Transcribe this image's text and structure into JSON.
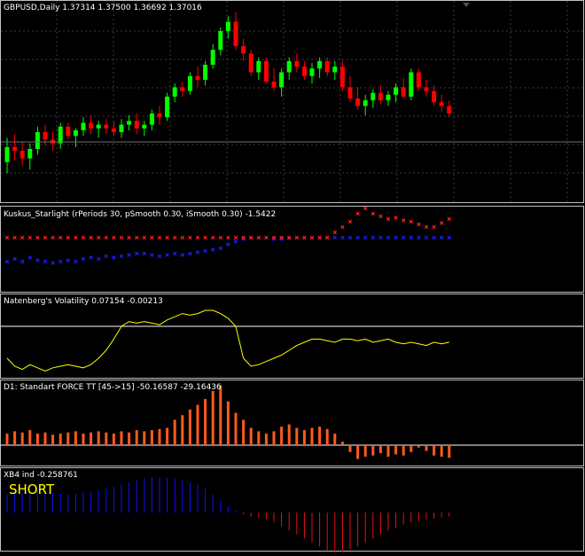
{
  "colors": {
    "background": "#000000",
    "grid": "#3c3c3c",
    "separator": "#c0c0c0",
    "bull": "#00ff00",
    "bear": "#ff0000",
    "text": "#ffffff",
    "starlight_blue": "#2020ff",
    "starlight_red": "#ff2020",
    "volatility_line": "#ffff00",
    "level_line": "#ffffff",
    "force_bar": "#ff5a1e",
    "xb4_pos": "#1010ff",
    "xb4_neg": "#e81010",
    "short_text": "#ffff00"
  },
  "main": {
    "header": "GBPUSD,Daily  1.37314 1.37500 1.36692 1.37016",
    "scroll_marker_icon": "triangle-down-icon"
  },
  "indicators": {
    "kuskus": {
      "label": "Kuskus_Starlight  (rPeriods 30, pSmooth 0.30, iSmooth 0.30)  -1.5422"
    },
    "volatility": {
      "label": "Natenberg's Volatility 0.07154 -0.00213"
    },
    "force": {
      "label": "D1: Standart FORCE TT [45->15] -50.16587 -29.16436"
    },
    "xb4": {
      "label": "XB4 ind -0.258761",
      "signal": "SHORT"
    }
  },
  "chart_data": [
    {
      "type": "candlestick",
      "title": "GBPUSD,Daily",
      "ohlc_last": {
        "open": 1.37314,
        "high": 1.375,
        "low": 1.36692,
        "close": 1.37016
      },
      "bars": 61,
      "candles": [
        [
          0.2,
          0.33,
          0.14,
          0.28
        ],
        [
          0.28,
          0.35,
          0.21,
          0.26
        ],
        [
          0.26,
          0.31,
          0.18,
          0.22
        ],
        [
          0.22,
          0.3,
          0.16,
          0.27
        ],
        [
          0.27,
          0.39,
          0.24,
          0.36
        ],
        [
          0.36,
          0.4,
          0.29,
          0.32
        ],
        [
          0.32,
          0.36,
          0.26,
          0.3
        ],
        [
          0.3,
          0.41,
          0.27,
          0.39
        ],
        [
          0.39,
          0.41,
          0.32,
          0.34
        ],
        [
          0.34,
          0.38,
          0.28,
          0.37
        ],
        [
          0.37,
          0.44,
          0.34,
          0.41
        ],
        [
          0.41,
          0.45,
          0.35,
          0.38
        ],
        [
          0.38,
          0.42,
          0.33,
          0.4
        ],
        [
          0.4,
          0.43,
          0.35,
          0.38
        ],
        [
          0.38,
          0.42,
          0.34,
          0.36
        ],
        [
          0.36,
          0.43,
          0.33,
          0.4
        ],
        [
          0.4,
          0.45,
          0.37,
          0.42
        ],
        [
          0.42,
          0.46,
          0.35,
          0.38
        ],
        [
          0.38,
          0.42,
          0.34,
          0.4
        ],
        [
          0.4,
          0.48,
          0.37,
          0.46
        ],
        [
          0.46,
          0.5,
          0.4,
          0.44
        ],
        [
          0.44,
          0.57,
          0.42,
          0.55
        ],
        [
          0.55,
          0.62,
          0.52,
          0.6
        ],
        [
          0.6,
          0.63,
          0.55,
          0.58
        ],
        [
          0.58,
          0.68,
          0.56,
          0.66
        ],
        [
          0.66,
          0.71,
          0.6,
          0.64
        ],
        [
          0.64,
          0.74,
          0.61,
          0.72
        ],
        [
          0.72,
          0.83,
          0.7,
          0.8
        ],
        [
          0.8,
          0.92,
          0.77,
          0.9
        ],
        [
          0.9,
          0.98,
          0.86,
          0.95
        ],
        [
          0.95,
          1.0,
          0.8,
          0.82
        ],
        [
          0.82,
          0.86,
          0.74,
          0.78
        ],
        [
          0.78,
          0.8,
          0.66,
          0.68
        ],
        [
          0.68,
          0.76,
          0.64,
          0.74
        ],
        [
          0.74,
          0.76,
          0.62,
          0.63
        ],
        [
          0.63,
          0.7,
          0.58,
          0.6
        ],
        [
          0.6,
          0.7,
          0.55,
          0.68
        ],
        [
          0.68,
          0.76,
          0.64,
          0.74
        ],
        [
          0.74,
          0.78,
          0.68,
          0.71
        ],
        [
          0.71,
          0.74,
          0.64,
          0.66
        ],
        [
          0.66,
          0.73,
          0.62,
          0.7
        ],
        [
          0.7,
          0.76,
          0.65,
          0.74
        ],
        [
          0.74,
          0.76,
          0.66,
          0.68
        ],
        [
          0.68,
          0.74,
          0.64,
          0.71
        ],
        [
          0.71,
          0.74,
          0.58,
          0.6
        ],
        [
          0.6,
          0.66,
          0.52,
          0.54
        ],
        [
          0.54,
          0.6,
          0.48,
          0.5
        ],
        [
          0.5,
          0.56,
          0.45,
          0.53
        ],
        [
          0.53,
          0.59,
          0.49,
          0.57
        ],
        [
          0.57,
          0.61,
          0.51,
          0.53
        ],
        [
          0.53,
          0.58,
          0.5,
          0.56
        ],
        [
          0.56,
          0.62,
          0.52,
          0.6
        ],
        [
          0.6,
          0.65,
          0.54,
          0.55
        ],
        [
          0.55,
          0.7,
          0.53,
          0.68
        ],
        [
          0.68,
          0.7,
          0.58,
          0.6
        ],
        [
          0.6,
          0.64,
          0.55,
          0.58
        ],
        [
          0.58,
          0.61,
          0.5,
          0.52
        ],
        [
          0.52,
          0.56,
          0.47,
          0.5
        ],
        [
          0.5,
          0.53,
          0.44,
          0.46
        ]
      ]
    },
    {
      "type": "scatter",
      "title": "Kuskus_Starlight",
      "series": [
        {
          "values": [
            -0.8,
            -0.6,
            -0.8,
            -0.5,
            -0.7,
            -0.8,
            -0.9,
            -0.8,
            -0.7,
            -0.8,
            -0.6,
            -0.5,
            -0.6,
            -0.4,
            -0.5,
            -0.4,
            -0.3,
            -0.2,
            -0.2,
            -0.3,
            -0.4,
            -0.3,
            -0.2,
            -0.3,
            -0.2,
            -0.1,
            0.0,
            0.1,
            0.2,
            0.5,
            0.7,
            0.9,
            1.0,
            1.0,
            1.0,
            0.9,
            0.9,
            0.95,
            1.0,
            1.0,
            1.0,
            1.0,
            1.0,
            1.0,
            1.0,
            1.0,
            1.0,
            1.0,
            1.0,
            1.0,
            1.0,
            1.0,
            1.0,
            1.0,
            1.0,
            1.0,
            1.0,
            1.0,
            1.0
          ]
        },
        {
          "values": [
            1.0,
            1.0,
            1.0,
            1.0,
            1.0,
            1.0,
            1.0,
            1.0,
            1.0,
            1.0,
            1.0,
            1.0,
            1.0,
            1.0,
            1.0,
            1.0,
            1.0,
            1.0,
            1.0,
            1.0,
            1.0,
            1.0,
            1.0,
            1.0,
            1.0,
            1.0,
            1.0,
            1.0,
            1.0,
            1.0,
            1.0,
            1.0,
            1.0,
            1.0,
            1.0,
            1.0,
            1.0,
            1.0,
            1.0,
            1.0,
            1.0,
            1.0,
            1.0,
            1.4,
            1.8,
            2.2,
            2.8,
            3.2,
            2.8,
            2.6,
            2.4,
            2.5,
            2.3,
            2.2,
            2.0,
            1.8,
            1.8,
            2.1,
            2.4
          ]
        }
      ]
    },
    {
      "type": "line",
      "title": "Natenberg's Volatility",
      "values": [
        0.1,
        0.05,
        0.03,
        0.06,
        0.04,
        0.02,
        0.04,
        0.05,
        0.06,
        0.05,
        0.04,
        0.06,
        0.1,
        0.15,
        0.22,
        0.3,
        0.33,
        0.32,
        0.33,
        0.32,
        0.31,
        0.34,
        0.36,
        0.38,
        0.37,
        0.38,
        0.4,
        0.4,
        0.38,
        0.35,
        0.3,
        0.1,
        0.05,
        0.06,
        0.08,
        0.1,
        0.12,
        0.15,
        0.18,
        0.2,
        0.22,
        0.22,
        0.21,
        0.2,
        0.22,
        0.22,
        0.21,
        0.22,
        0.2,
        0.21,
        0.22,
        0.2,
        0.19,
        0.2,
        0.19,
        0.18,
        0.2,
        0.19,
        0.2
      ],
      "level": 0.3
    },
    {
      "type": "bar",
      "title": "D1: Standart FORCE TT [45->15]",
      "values": [
        10,
        12,
        11,
        13,
        10,
        11,
        9,
        10,
        11,
        12,
        10,
        11,
        12,
        11,
        10,
        12,
        11,
        13,
        12,
        13,
        14,
        15,
        22,
        26,
        31,
        35,
        40,
        47,
        52,
        38,
        28,
        22,
        15,
        12,
        10,
        12,
        16,
        18,
        15,
        13,
        15,
        16,
        14,
        10,
        3,
        -6,
        -12,
        -10,
        -9,
        -7,
        -10,
        -8,
        -9,
        -6,
        -2,
        -5,
        -9,
        -10,
        -11
      ]
    },
    {
      "type": "bar",
      "title": "XB4 ind",
      "values": [
        0.45,
        0.5,
        0.48,
        0.52,
        0.55,
        0.53,
        0.5,
        0.48,
        0.45,
        0.47,
        0.5,
        0.52,
        0.55,
        0.6,
        0.65,
        0.7,
        0.75,
        0.8,
        0.85,
        0.9,
        0.88,
        0.87,
        0.85,
        0.8,
        0.75,
        0.7,
        0.6,
        0.45,
        0.3,
        0.15,
        0.05,
        -0.05,
        -0.1,
        -0.12,
        -0.18,
        -0.25,
        -0.35,
        -0.45,
        -0.55,
        -0.65,
        -0.75,
        -0.85,
        -0.95,
        -1.0,
        -0.98,
        -0.92,
        -0.85,
        -0.75,
        -0.65,
        -0.55,
        -0.45,
        -0.38,
        -0.3,
        -0.25,
        -0.22,
        -0.18,
        -0.15,
        -0.12,
        -0.1
      ]
    }
  ]
}
